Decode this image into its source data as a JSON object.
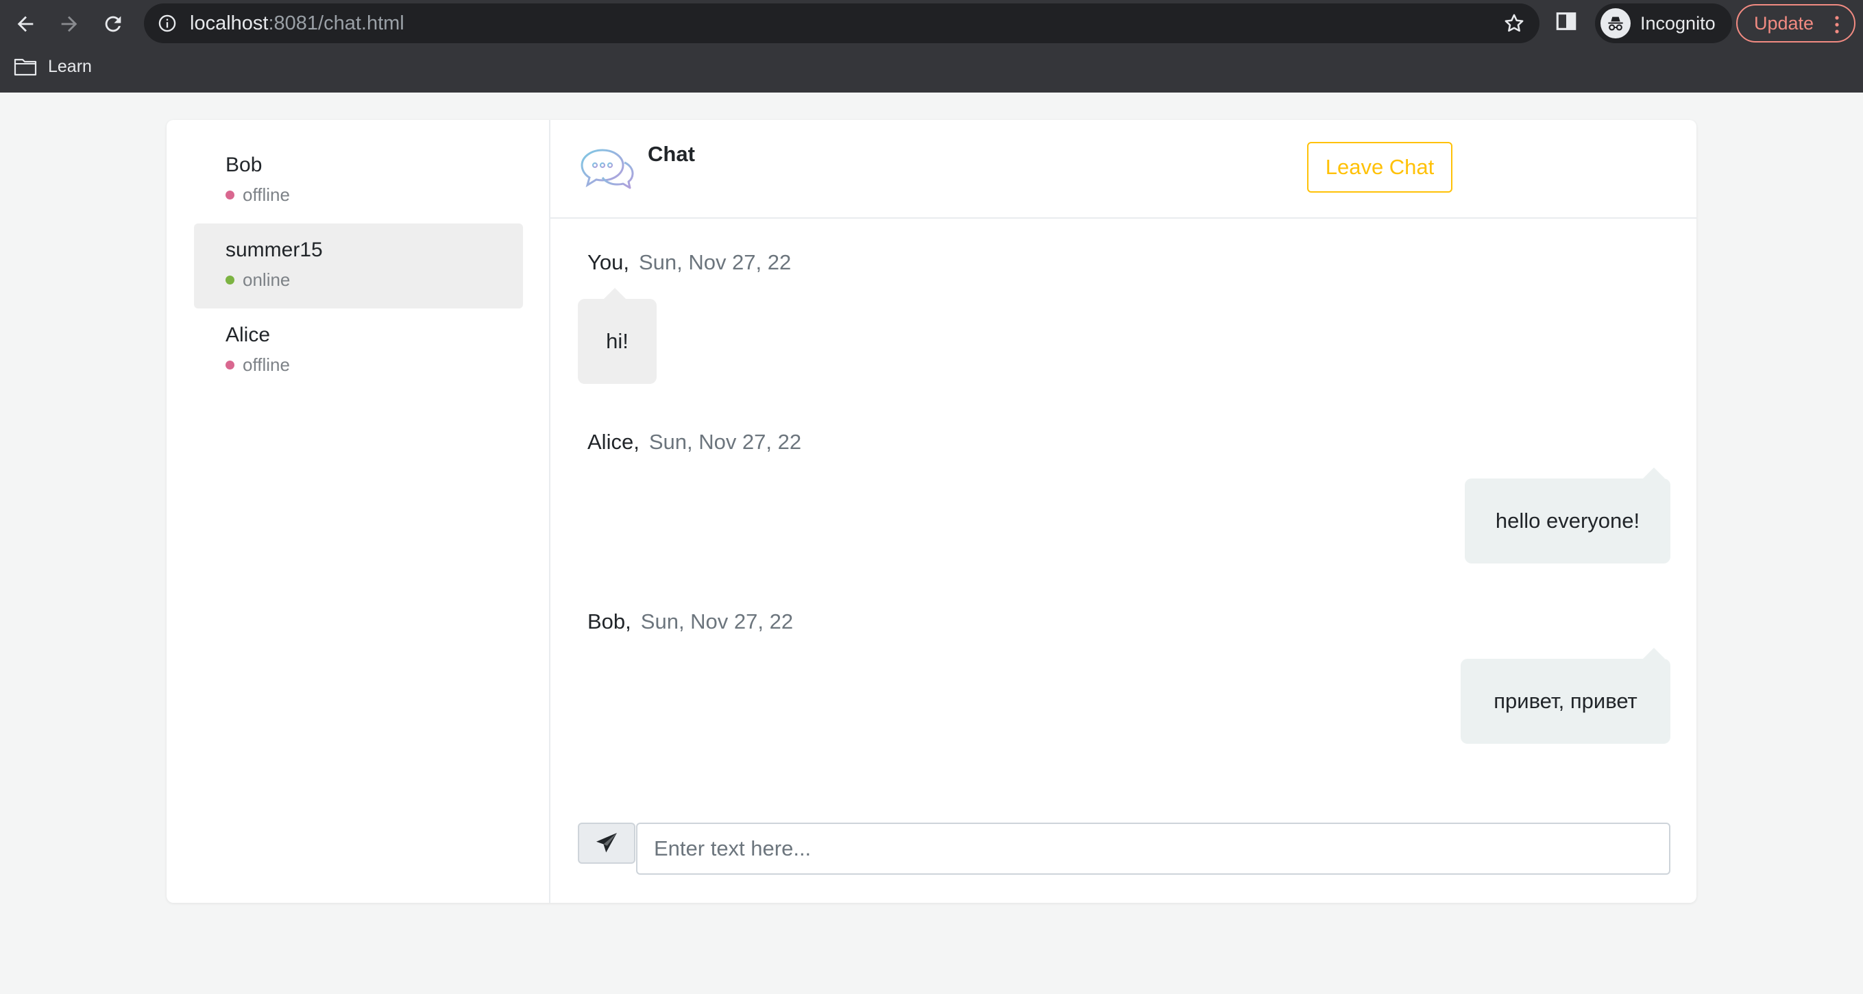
{
  "browser": {
    "url_host": "localhost",
    "url_path": ":8081/chat.html",
    "profile_label": "Incognito",
    "update_label": "Update",
    "bookmarks": [
      {
        "label": "Learn"
      }
    ]
  },
  "sidebar": {
    "users": [
      {
        "name": "Bob",
        "status": "offline",
        "status_color": "#d9678f",
        "active": false
      },
      {
        "name": "summer15",
        "status": "online",
        "status_color": "#7cb342",
        "active": true
      },
      {
        "name": "Alice",
        "status": "offline",
        "status_color": "#d9678f",
        "active": false
      }
    ]
  },
  "chat": {
    "title": "Chat",
    "leave_label": "Leave Chat",
    "messages": [
      {
        "author": "You,",
        "time": "Sun, Nov 27, 22",
        "text": "hi!",
        "side": "left"
      },
      {
        "author": "Alice,",
        "time": "Sun, Nov 27, 22",
        "text": "hello everyone!",
        "side": "right"
      },
      {
        "author": "Bob,",
        "time": "Sun, Nov 27, 22",
        "text": "привет, привет",
        "side": "right"
      }
    ],
    "input_placeholder": "Enter text here...",
    "input_value": ""
  },
  "colors": {
    "accent_warning": "#ffc107",
    "status_online": "#7cb342",
    "status_offline": "#d9678f"
  }
}
